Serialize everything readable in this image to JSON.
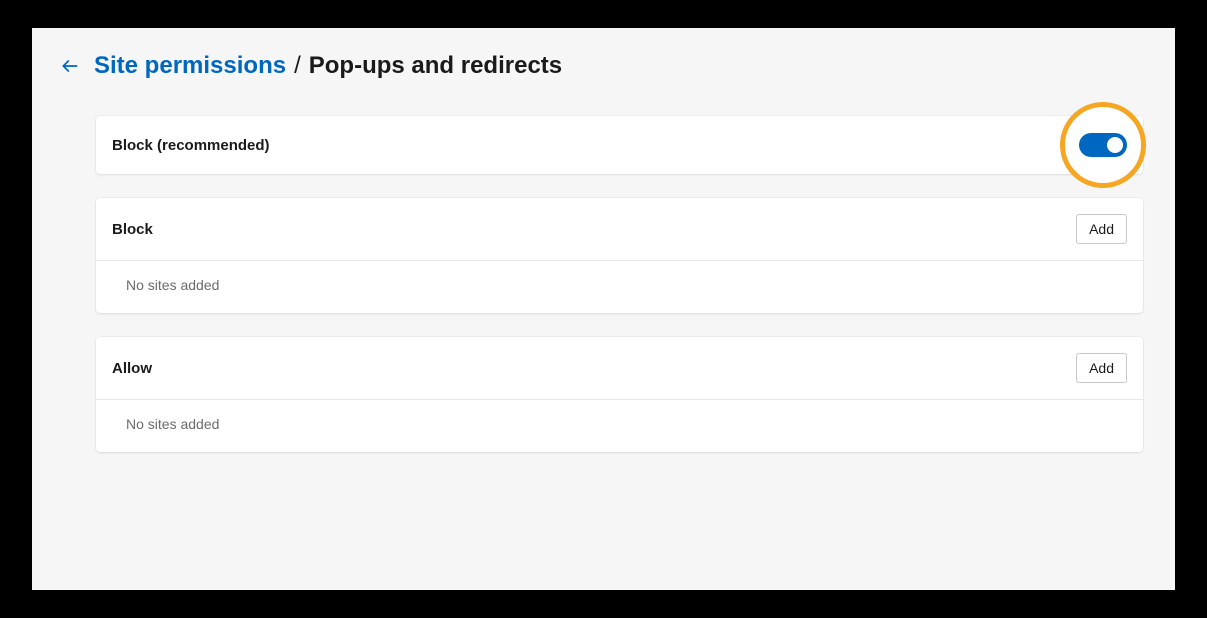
{
  "breadcrumb": {
    "parent": "Site permissions",
    "separator": "/",
    "current": "Pop-ups and redirects"
  },
  "main_toggle": {
    "label": "Block (recommended)",
    "enabled": true
  },
  "sections": {
    "block": {
      "title": "Block",
      "add_label": "Add",
      "empty_text": "No sites added"
    },
    "allow": {
      "title": "Allow",
      "add_label": "Add",
      "empty_text": "No sites added"
    }
  }
}
